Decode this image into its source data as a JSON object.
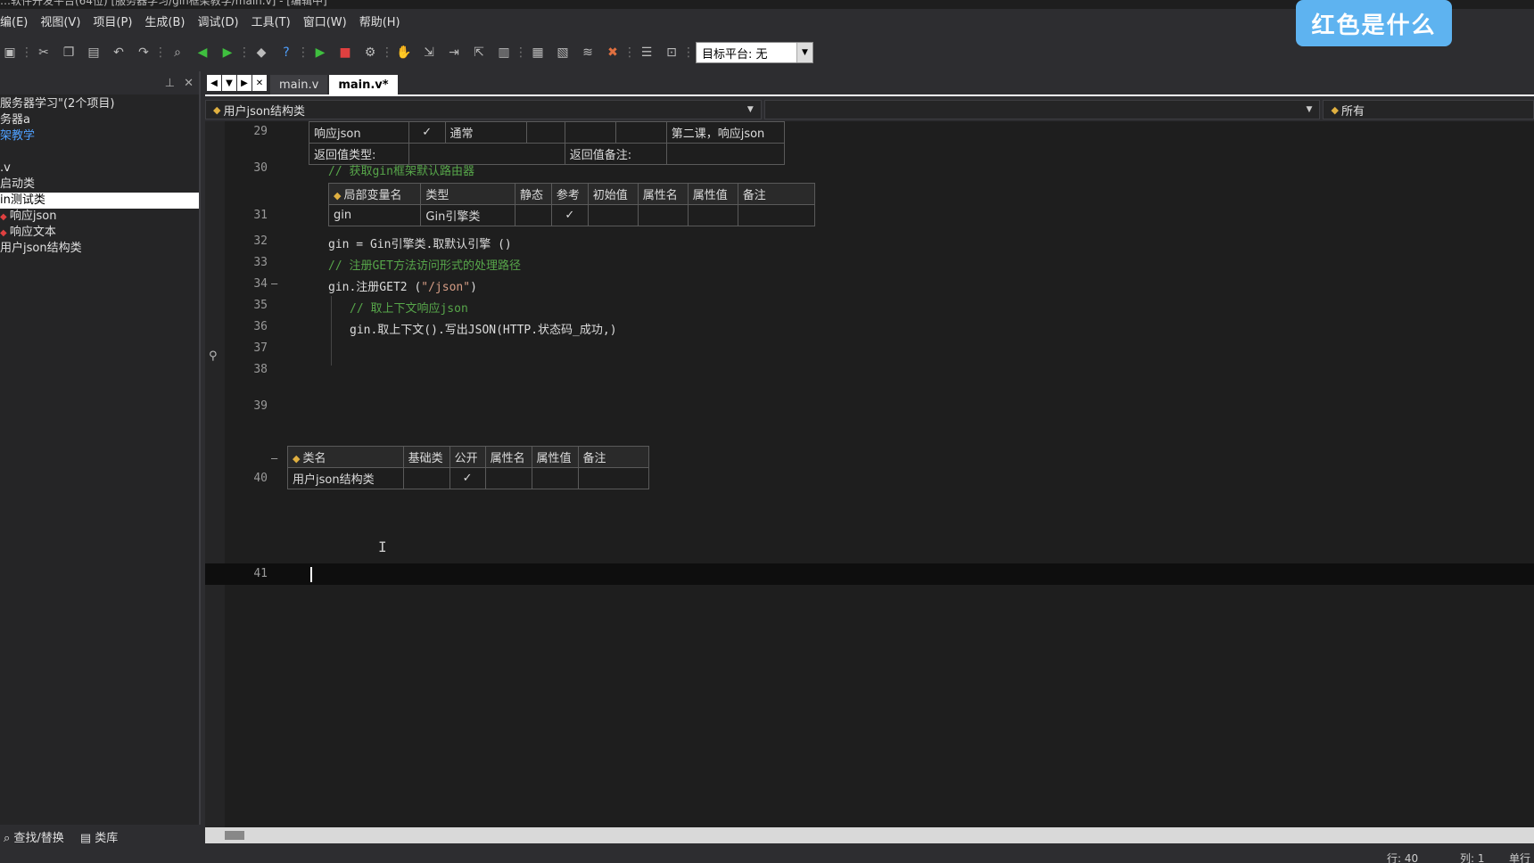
{
  "window": {
    "title": "…软件开发平台(64位) [服务器学习/gin框架教学/main.v] - [编辑中]"
  },
  "menu": [
    "编(E)",
    "视图(V)",
    "项目(P)",
    "生成(B)",
    "调试(D)",
    "工具(T)",
    "窗口(W)",
    "帮助(H)"
  ],
  "overlay": {
    "button_label": "红色是什么"
  },
  "toolbar": {
    "icons": [
      "save-all-icon",
      "cut-icon",
      "copy-icon",
      "paste-icon",
      "undo-icon",
      "redo-icon",
      "find-icon",
      "back-icon",
      "forward-icon",
      "build-icon",
      "help-icon",
      "run-icon",
      "stop-icon",
      "debug-icon",
      "hand-icon",
      "step-icon",
      "step-over-icon",
      "step-out-icon",
      "breakpoint-icon",
      "chart-icon",
      "window-icon",
      "layers-icon",
      "delete-icon",
      "list-icon",
      "zoom-icon"
    ],
    "platform_label": "目标平台: 无"
  },
  "left_panel": {
    "items": [
      {
        "text": "服务器学习\"(2个项目)",
        "style": "normal"
      },
      {
        "text": "务器a",
        "style": "normal"
      },
      {
        "text": "架教学",
        "style": "link"
      },
      {
        "text": "",
        "style": "normal"
      },
      {
        "text": ".v",
        "style": "normal"
      },
      {
        "text": "启动类",
        "style": "normal"
      },
      {
        "text": "in测试类",
        "style": "selected"
      },
      {
        "text": "响应json",
        "style": "bullet"
      },
      {
        "text": "响应文本",
        "style": "bullet"
      },
      {
        "text": "用户json结构类",
        "style": "normal"
      }
    ],
    "bottom_tabs": [
      "查找/替换",
      "类库"
    ]
  },
  "tabs": [
    {
      "label": "main.v",
      "active": false
    },
    {
      "label": "main.v*",
      "active": true
    }
  ],
  "dropdowns": {
    "class_selector": "用户json结构类",
    "method_selector": "",
    "scope_selector": "所有"
  },
  "editor": {
    "line_numbers": {
      "l29": "29",
      "l30": "30",
      "l31": "31",
      "l32": "32",
      "l33": "33",
      "l34": "34",
      "l35": "35",
      "l36": "36",
      "l37": "37",
      "l38": "38",
      "l39": "39",
      "l40": "40",
      "l41": "41"
    },
    "method_row": {
      "name": "响应json",
      "check": "✓",
      "type": "通常",
      "note": "第二课，响应json",
      "ret_type_label": "返回值类型:",
      "ret_note_label": "返回值备注:"
    },
    "comment_30": "// 获取gin框架默认路由器",
    "local_var_table": {
      "headers": [
        "局部变量名",
        "类型",
        "静态",
        "参考",
        "初始值",
        "属性名",
        "属性值",
        "备注"
      ],
      "row": {
        "name": "gin",
        "type": "Gin引擎类",
        "static": "",
        "ref": "✓"
      }
    },
    "line_32": "gin = Gin引擎类.取默认引擎 ()",
    "comment_33": "// 注册GET方法访问形式的处理路径",
    "line_34_prefix": "gin.注册GET2 (",
    "line_34_string": "\"/json\"",
    "line_34_suffix": ")",
    "comment_35": "// 取上下文响应json",
    "line_36": "gin.取上下文().写出JSON(HTTP.状态码_成功,)",
    "class_table": {
      "headers": [
        "类名",
        "基础类",
        "公开",
        "属性名",
        "属性值",
        "备注"
      ],
      "row": {
        "name": "用户json结构类",
        "base": "",
        "public": "✓"
      }
    }
  },
  "status": {
    "row": "行: 40",
    "col": "列: 1",
    "mode": "单行"
  }
}
